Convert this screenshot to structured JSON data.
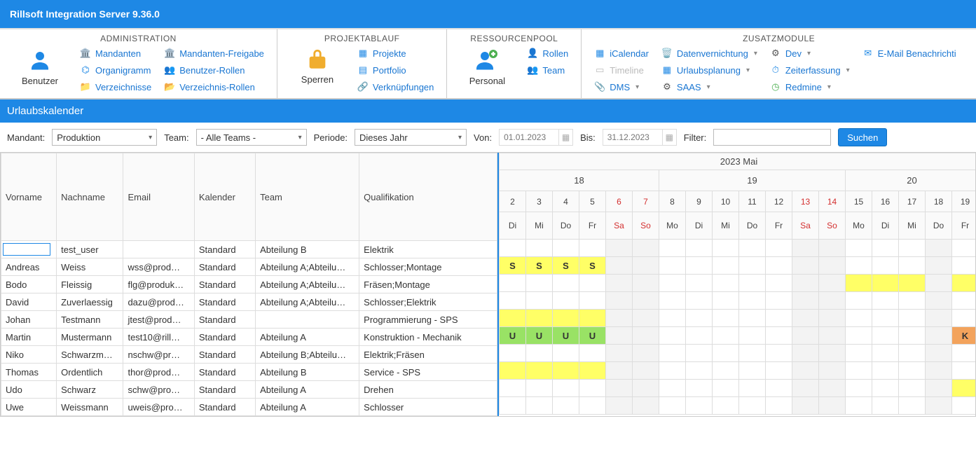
{
  "app": {
    "title": "Rillsoft Integration Server 9.36.0"
  },
  "ribbon": {
    "groups": {
      "administration": {
        "title": "ADMINISTRATION",
        "big": "Benutzer",
        "items": {
          "mandanten": "Mandanten",
          "mandanten_freigabe": "Mandanten-Freigabe",
          "organigramm": "Organigramm",
          "benutzer_rollen": "Benutzer-Rollen",
          "verzeichnisse": "Verzeichnisse",
          "verzeichnis_rollen": "Verzeichnis-Rollen"
        }
      },
      "projektablauf": {
        "title": "PROJEKTABLAUF",
        "big": "Sperren",
        "items": {
          "projekte": "Projekte",
          "portfolio": "Portfolio",
          "verknuepfungen": "Verknüpfungen"
        }
      },
      "ressourcenpool": {
        "title": "RESSOURCENPOOL",
        "big": "Personal",
        "items": {
          "rollen": "Rollen",
          "team": "Team"
        }
      },
      "zusatzmodule": {
        "title": "ZUSATZMODULE",
        "items": {
          "icalendar": "iCalendar",
          "timeline": "Timeline",
          "dms": "DMS",
          "datenvernichtung": "Datenvernichtung",
          "urlaubsplanung": "Urlaubsplanung",
          "saas": "SAAS",
          "dev": "Dev",
          "zeiterfassung": "Zeiterfassung",
          "redmine": "Redmine",
          "email_benach": "E-Mail Benachrichti"
        }
      }
    }
  },
  "section": {
    "title": "Urlaubskalender"
  },
  "filter": {
    "mandant_label": "Mandant:",
    "mandant_value": "Produktion",
    "team_label": "Team:",
    "team_value": "- Alle Teams -",
    "period_label": "Periode:",
    "period_value": "Dieses Jahr",
    "von_label": "Von:",
    "von_value": "01.01.2023",
    "bis_label": "Bis:",
    "bis_value": "31.12.2023",
    "filter_label": "Filter:",
    "search_btn": "Suchen"
  },
  "left_columns": {
    "vorname": "Vorname",
    "nachname": "Nachname",
    "email": "Email",
    "kalender": "Kalender",
    "team": "Team",
    "qualifikation": "Qualifikation"
  },
  "right_header": {
    "month": "2023 Mai",
    "weeks": [
      "18",
      "19",
      "20"
    ],
    "days": [
      "2",
      "3",
      "4",
      "5",
      "6",
      "7",
      "8",
      "9",
      "10",
      "11",
      "12",
      "13",
      "14",
      "15",
      "16",
      "17",
      "18",
      "19"
    ],
    "dows": [
      "Di",
      "Mi",
      "Do",
      "Fr",
      "Sa",
      "So",
      "Mo",
      "Di",
      "Mi",
      "Do",
      "Fr",
      "Sa",
      "So",
      "Mo",
      "Di",
      "Mi",
      "Do",
      "Fr"
    ],
    "weekend_idx": [
      4,
      5,
      11,
      12
    ]
  },
  "rows": [
    {
      "vorname": "",
      "nachname": "test_user",
      "email": "",
      "kalender": "Standard",
      "team": "Abteilung B",
      "qual": "Elektrik",
      "cells": {},
      "input_first": true
    },
    {
      "vorname": "Andreas",
      "nachname": "Weiss",
      "email": "wss@prod…",
      "kalender": "Standard",
      "team": "Abteilung A;Abteilu…",
      "qual": "Schlosser;Montage",
      "cells": {
        "0": {
          "txt": "S",
          "cls": "cell-yellow-s"
        },
        "1": {
          "txt": "S",
          "cls": "cell-yellow-s"
        },
        "2": {
          "txt": "S",
          "cls": "cell-yellow-s"
        },
        "3": {
          "txt": "S",
          "cls": "cell-yellow-s"
        }
      }
    },
    {
      "vorname": "Bodo",
      "nachname": "Fleissig",
      "email": "flg@produk…",
      "kalender": "Standard",
      "team": "Abteilung A;Abteilu…",
      "qual": "Fräsen;Montage",
      "cells": {
        "13": {
          "cls": "cell-yellow"
        },
        "14": {
          "cls": "cell-yellow"
        },
        "15": {
          "cls": "cell-yellow"
        },
        "17": {
          "cls": "cell-yellow"
        }
      }
    },
    {
      "vorname": "David",
      "nachname": "Zuverlaessig",
      "email": "dazu@prod…",
      "kalender": "Standard",
      "team": "Abteilung A;Abteilu…",
      "qual": "Schlosser;Elektrik",
      "cells": {}
    },
    {
      "vorname": "Johan",
      "nachname": "Testmann",
      "email": "jtest@prod…",
      "kalender": "Standard",
      "team": "",
      "qual": "Programmierung - SPS",
      "cells": {
        "0": {
          "cls": "cell-yellow"
        },
        "1": {
          "cls": "cell-yellow"
        },
        "2": {
          "cls": "cell-yellow"
        },
        "3": {
          "cls": "cell-yellow"
        }
      }
    },
    {
      "vorname": "Martin",
      "nachname": "Mustermann",
      "email": "test10@rill…",
      "kalender": "Standard",
      "team": "Abteilung A",
      "qual": "Konstruktion - Mechanik",
      "cells": {
        "0": {
          "txt": "U",
          "cls": "cell-green"
        },
        "1": {
          "txt": "U",
          "cls": "cell-green"
        },
        "2": {
          "txt": "U",
          "cls": "cell-green"
        },
        "3": {
          "txt": "U",
          "cls": "cell-green"
        },
        "17": {
          "txt": "K",
          "cls": "cell-orange"
        }
      }
    },
    {
      "vorname": "Niko",
      "nachname": "Schwarzm…",
      "email": "nschw@pr…",
      "kalender": "Standard",
      "team": "Abteilung B;Abteilu…",
      "qual": "Elektrik;Fräsen",
      "cells": {}
    },
    {
      "vorname": "Thomas",
      "nachname": "Ordentlich",
      "email": "thor@prod…",
      "kalender": "Standard",
      "team": "Abteilung B",
      "qual": "Service - SPS",
      "cells": {
        "0": {
          "cls": "cell-yellow"
        },
        "1": {
          "cls": "cell-yellow"
        },
        "2": {
          "cls": "cell-yellow"
        },
        "3": {
          "cls": "cell-yellow"
        }
      }
    },
    {
      "vorname": "Udo",
      "nachname": "Schwarz",
      "email": "schw@pro…",
      "kalender": "Standard",
      "team": "Abteilung A",
      "qual": "Drehen",
      "cells": {
        "17": {
          "cls": "cell-yellow"
        }
      }
    },
    {
      "vorname": "Uwe",
      "nachname": "Weissmann",
      "email": "uweis@pro…",
      "kalender": "Standard",
      "team": "Abteilung A",
      "qual": "Schlosser",
      "cells": {}
    }
  ]
}
